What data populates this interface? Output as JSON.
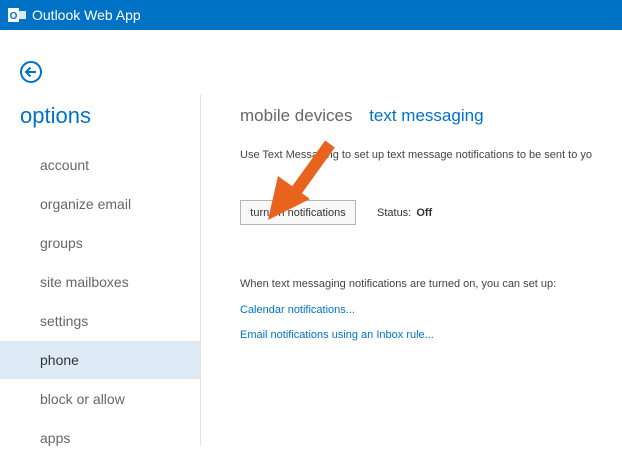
{
  "app": {
    "title": "Outlook Web App",
    "brand_color": "#0072c6",
    "logo_icon": "outlook-logo-icon"
  },
  "nav": {
    "back_icon": "back-arrow-icon",
    "options_title": "options",
    "items": [
      {
        "label": "account",
        "selected": false
      },
      {
        "label": "organize email",
        "selected": false
      },
      {
        "label": "groups",
        "selected": false
      },
      {
        "label": "site mailboxes",
        "selected": false
      },
      {
        "label": "settings",
        "selected": false
      },
      {
        "label": "phone",
        "selected": true
      },
      {
        "label": "block or allow",
        "selected": false
      },
      {
        "label": "apps",
        "selected": false
      }
    ]
  },
  "main": {
    "tabs": [
      {
        "label": "mobile devices",
        "active": false
      },
      {
        "label": "text messaging",
        "active": true
      }
    ],
    "description": "Use Text Messaging to set up text message notifications to be sent to yo",
    "turn_on_button": "turn on notifications",
    "status_label": "Status:",
    "status_value": "Off",
    "when_text": "When text messaging notifications are turned on, you can set up:",
    "links": {
      "calendar": "Calendar notifications...",
      "email": "Email notifications using an Inbox rule..."
    },
    "annotation_arrow_color": "#e8641e"
  }
}
